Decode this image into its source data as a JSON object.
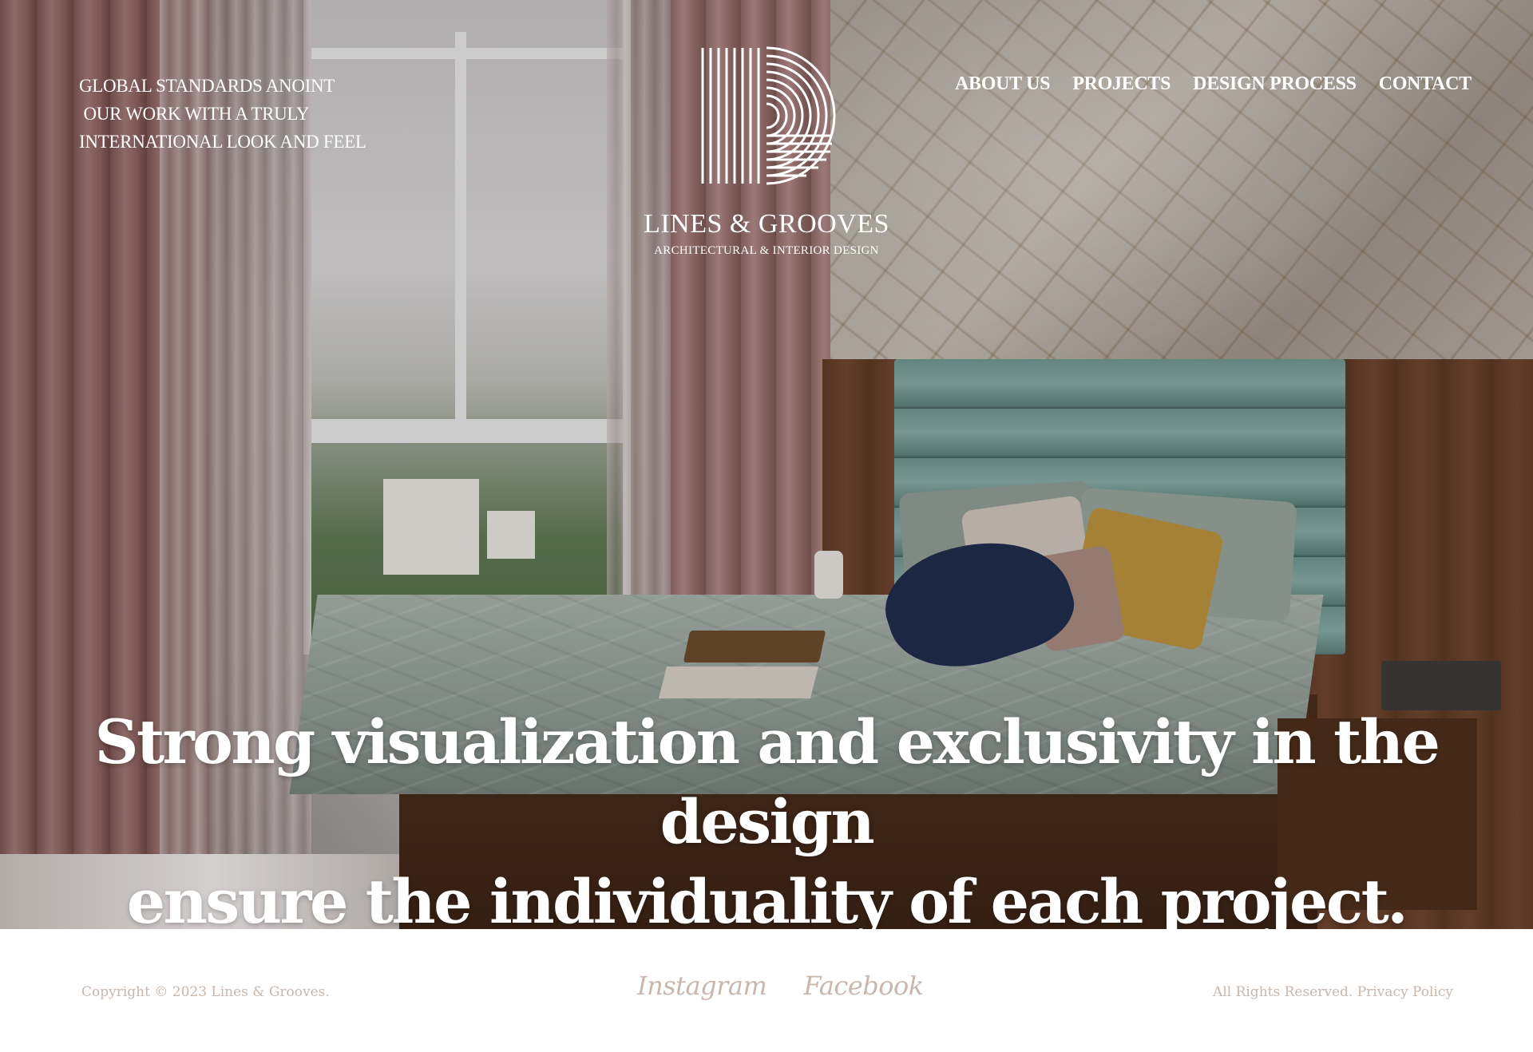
{
  "header": {
    "tagline_lines": [
      "GLOBAL STANDARDS ANOINT",
      " OUR WORK WITH A TRULY",
      "INTERNATIONAL LOOK AND FEEL"
    ],
    "logo": {
      "icon": "concentric-lines-logo-icon",
      "name": "LINES & GROOVES",
      "subtitle": "ARCHITECTURAL & INTERIOR DESIGN"
    },
    "nav": [
      {
        "label": "ABOUT US"
      },
      {
        "label": "PROJECTS"
      },
      {
        "label": "DESIGN PROCESS"
      },
      {
        "label": "CONTACT"
      }
    ]
  },
  "hero": {
    "headline_lines": [
      "Strong visualization and exclusivity in the design",
      "ensure the individuality of each project."
    ]
  },
  "footer": {
    "copyright": "Copyright © 2023 Lines & Grooves.",
    "socials": [
      {
        "label": "Instagram"
      },
      {
        "label": "Facebook"
      }
    ],
    "rights_text": "All Rights Reserved. ",
    "privacy_label": "Privacy Policy"
  },
  "colors": {
    "header_text": "#ffffff",
    "footer_text": "#c9b7ad",
    "footer_bg": "#ffffff"
  }
}
